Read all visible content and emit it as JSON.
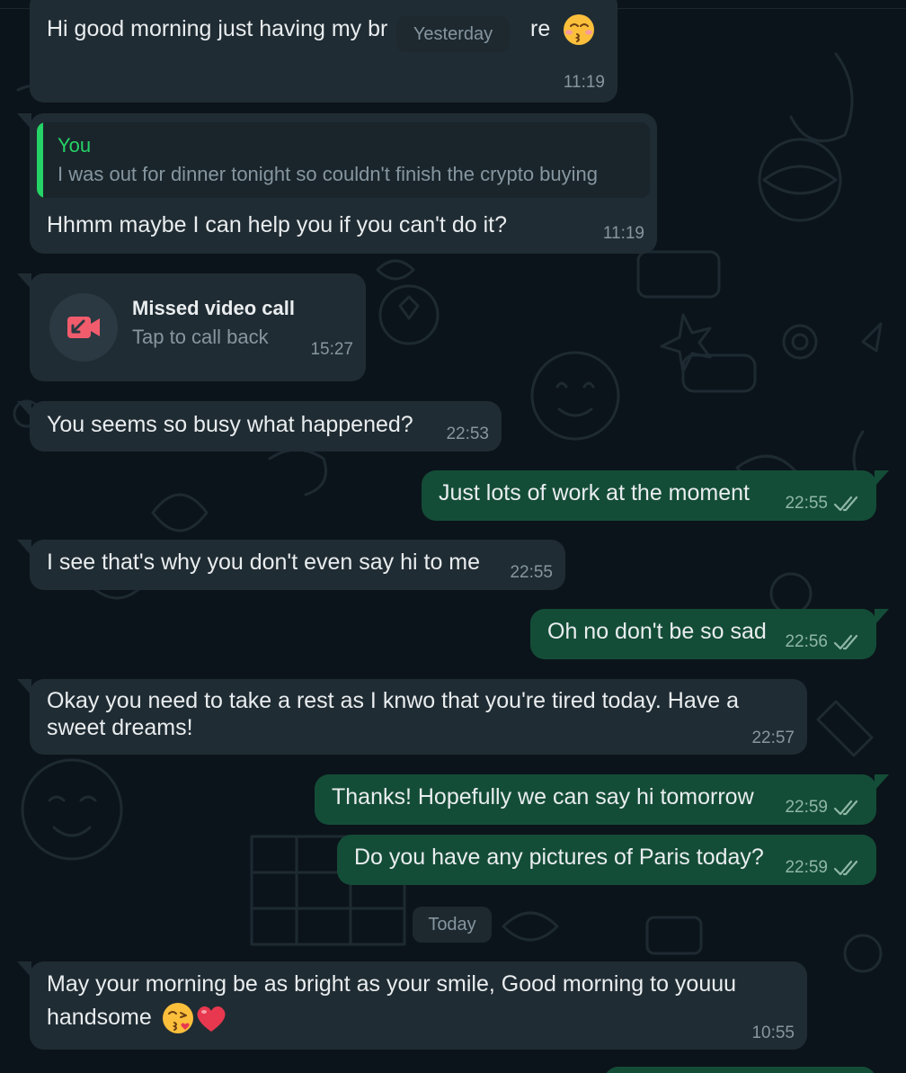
{
  "messages": [
    {
      "text": "Hi good morning just having my br",
      "text_tail": "re",
      "time": "11:19"
    },
    {
      "quote_author": "You",
      "quote_text": "I was out for dinner tonight so couldn't finish the crypto buying",
      "text": "Hhmm maybe I can help you if you can't do it?",
      "time": "11:19"
    },
    {
      "call_title": "Missed video call",
      "call_sub": "Tap to call back",
      "time": "15:27"
    },
    {
      "text": "You seems so busy what happened?",
      "time": "22:53"
    },
    {
      "text": "Just lots of work at the moment",
      "time": "22:55"
    },
    {
      "text": "I see that's why you don't even say hi to me",
      "time": "22:55"
    },
    {
      "text": "Oh no don't be so sad",
      "time": "22:56"
    },
    {
      "line1": "Okay you need to take a rest as I knwo that you're tired today. Have a",
      "line2": "sweet dreams!",
      "time": "22:57"
    },
    {
      "text": "Thanks! Hopefully we can say hi tomorrow",
      "time": "22:59"
    },
    {
      "text": "Do you have any pictures of Paris today?",
      "time": "22:59"
    },
    {
      "line1": "May your morning be as bright as your smile, Good morning to youuu",
      "line2": "handsome",
      "time": "10:55"
    }
  ],
  "date_separators": {
    "yesterday": "Yesterday",
    "today": "Today"
  },
  "icons": {
    "kiss_emoji": "kissing-face-with-closed-eyes",
    "blow_kiss_emoji": "face-blowing-a-kiss",
    "heart_emoji": "red-heart",
    "missed_call_icon": "missed-video-call",
    "read_receipt": "double-check"
  },
  "colors": {
    "background": "#0b141a",
    "incoming": "#202c33",
    "outgoing": "#144d37",
    "accent": "#25d366",
    "missed_call": "#f15c6d"
  }
}
